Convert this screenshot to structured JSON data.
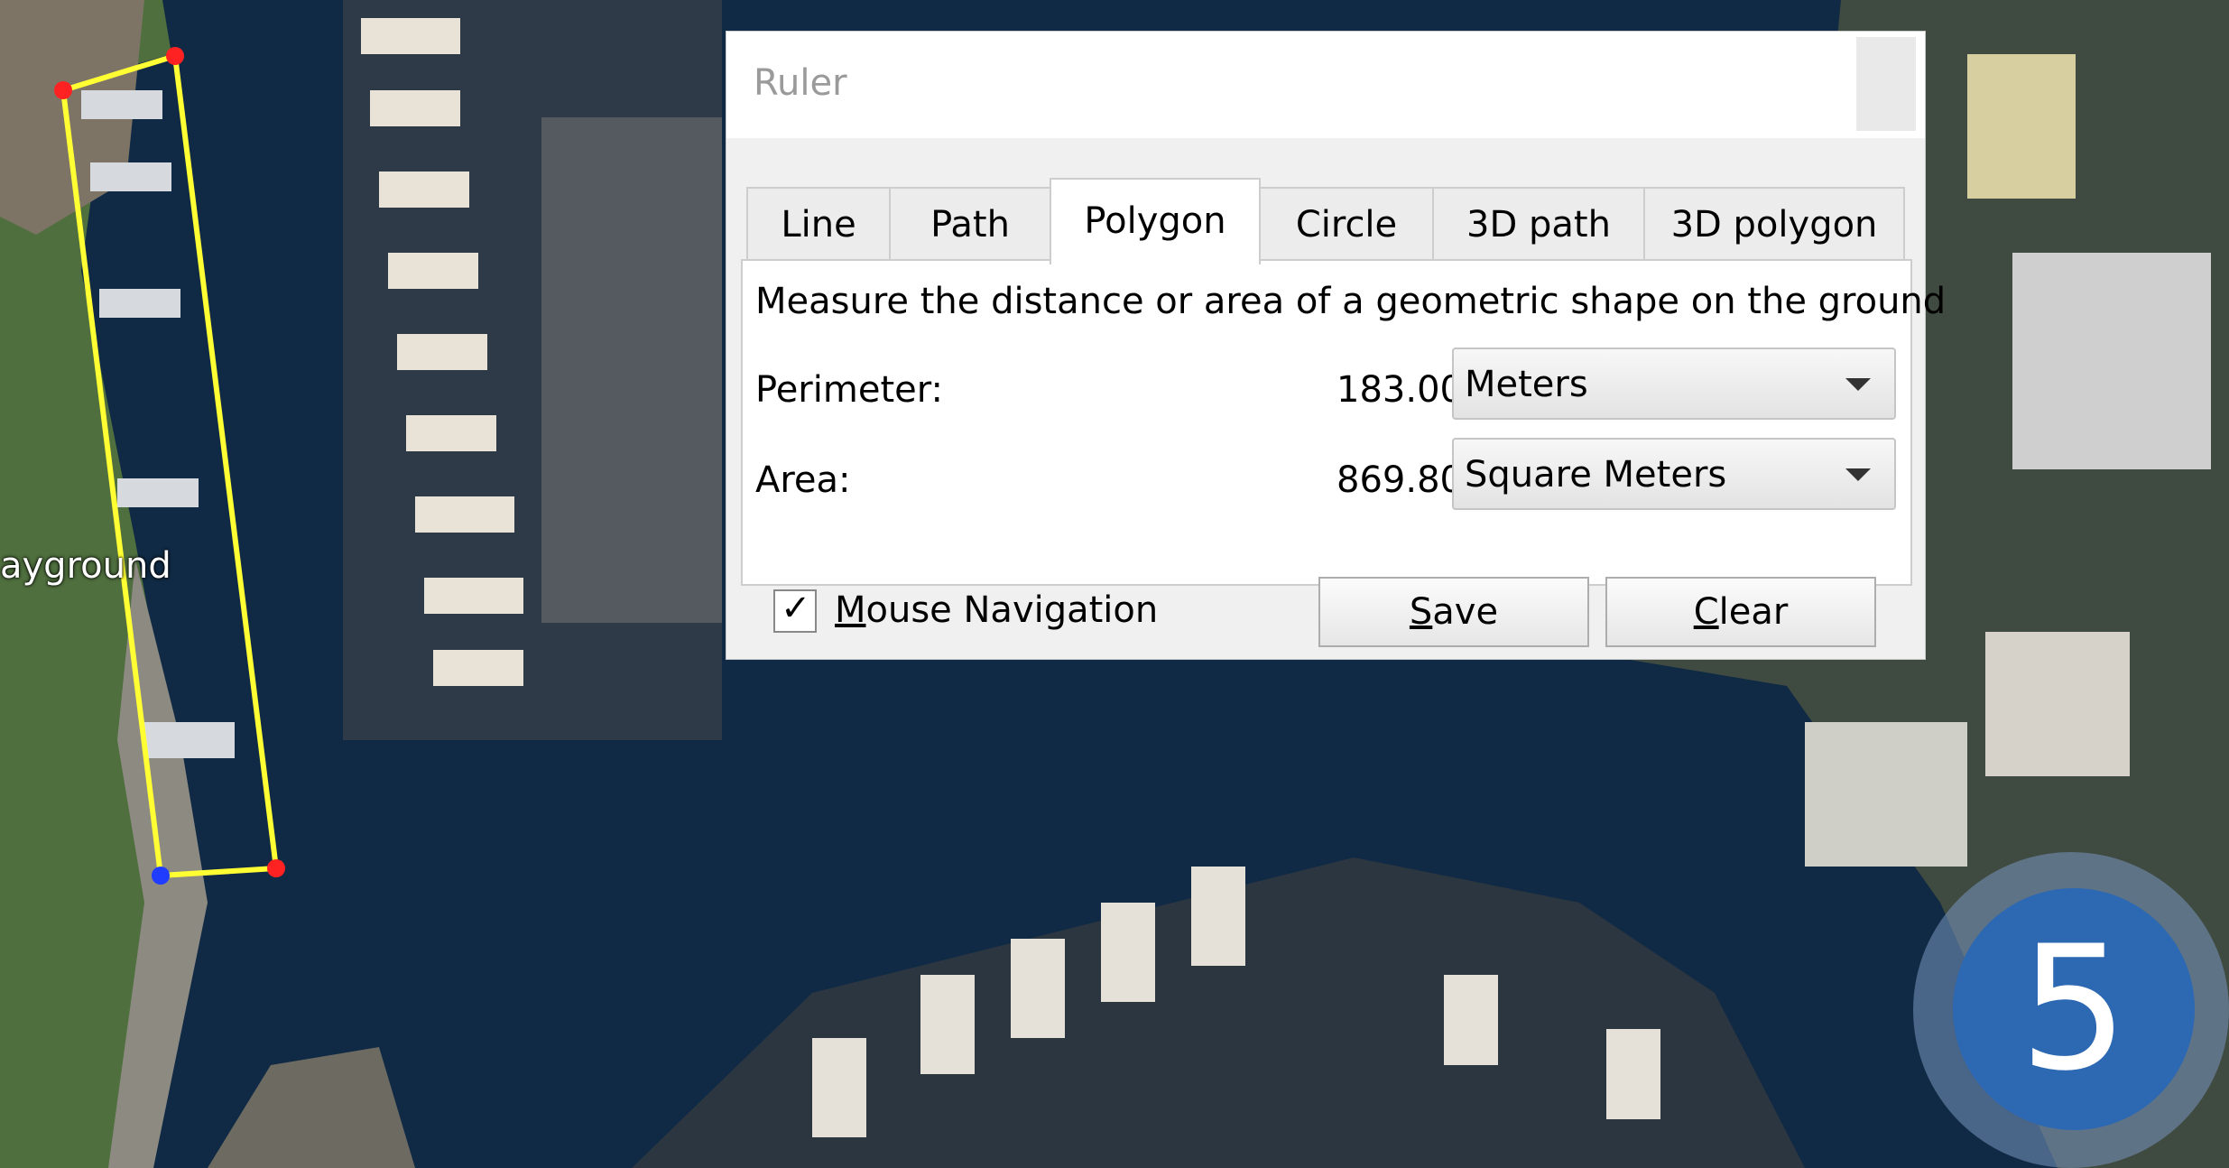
{
  "map": {
    "place_label": "ayground",
    "polygon_color": "#ffff33",
    "vertex_color": "#ff2222",
    "start_vertex_color": "#1f3cff",
    "water_color": "#102a45"
  },
  "dialog": {
    "title": "Ruler",
    "tabs": [
      {
        "label": "Line",
        "active": false
      },
      {
        "label": "Path",
        "active": false
      },
      {
        "label": "Polygon",
        "active": true
      },
      {
        "label": "Circle",
        "active": false
      },
      {
        "label": "3D path",
        "active": false
      },
      {
        "label": "3D polygon",
        "active": false
      }
    ],
    "description": "Measure the distance or area of a geometric shape on the ground",
    "perimeter": {
      "label": "Perimeter:",
      "value": "183.00",
      "unit": "Meters"
    },
    "area": {
      "label": "Area:",
      "value": "869.80",
      "unit": "Square Meters"
    },
    "mouse_navigation": {
      "label_first": "M",
      "label_rest": "ouse Navigation",
      "checked": true
    },
    "save": {
      "first": "S",
      "rest": "ave"
    },
    "clear": {
      "first": "C",
      "rest": "lear"
    }
  },
  "badge": {
    "number": "5",
    "color": "#2d68b3"
  }
}
